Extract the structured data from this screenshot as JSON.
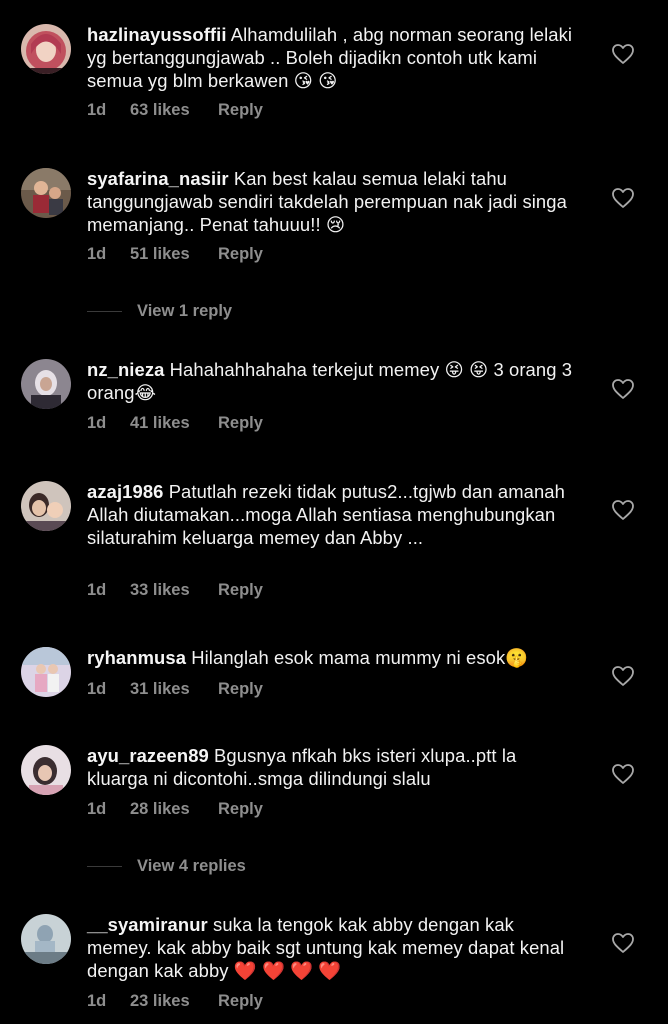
{
  "colors": {
    "background": "#000000",
    "text": "#f2f2f2",
    "secondary": "#8e8e8e",
    "divider": "#3a3a3a"
  },
  "comments": [
    {
      "username": "hazlinayussoffii",
      "text": " Alhamdulilah , abg norman seorang lelaki yg bertanggungjawab .. Boleh dijadikn contoh utk kami semua yg blm berkawen 😘 😘",
      "time": "1d",
      "likes": "63 likes",
      "reply": "Reply",
      "icon": "heart-outline-icon"
    },
    {
      "username": "syafarina_nasiir",
      "text": " Kan best kalau semua lelaki tahu tanggungjawab sendiri takdelah perempuan nak jadi singa memanjang.. Penat tahuuu!! 😢",
      "time": "1d",
      "likes": "51 likes",
      "reply": "Reply",
      "icon": "heart-outline-icon"
    },
    {
      "username": "nz_nieza",
      "text": " Hahahahhahaha terkejut memey 😝 😝 3 orang 3 orang😂",
      "time": "1d",
      "likes": "41 likes",
      "reply": "Reply",
      "icon": "heart-outline-icon"
    },
    {
      "username": "azaj1986",
      "text": " Patutlah rezeki tidak putus2...tgjwb dan amanah  Allah diutamakan...moga Allah sentiasa menghubungkan silaturahim keluarga memey dan Abby ...",
      "time": "1d",
      "likes": "33 likes",
      "reply": "Reply",
      "icon": "heart-outline-icon"
    },
    {
      "username": "ryhanmusa",
      "text": " Hilanglah esok mama mummy ni esok🤫",
      "time": "1d",
      "likes": "31 likes",
      "reply": "Reply",
      "icon": "heart-outline-icon"
    },
    {
      "username": "ayu_razeen89",
      "text": " Bgusnya nfkah bks isteri xlupa..ptt la kluarga ni dicontohi..smga dilindungi slalu",
      "time": "1d",
      "likes": "28 likes",
      "reply": "Reply",
      "icon": "heart-outline-icon"
    },
    {
      "username": "__syamiranur",
      "text": " suka la tengok kak abby dengan kak memey. kak abby baik sgt untung kak memey dapat kenal dengan kak abby ❤️ ❤️ ❤️ ❤️",
      "time": "1d",
      "likes": "23 likes",
      "reply": "Reply",
      "icon": "heart-outline-icon"
    }
  ],
  "view_replies": [
    {
      "label": "View 1 reply"
    },
    {
      "label": "View 4 replies"
    }
  ]
}
